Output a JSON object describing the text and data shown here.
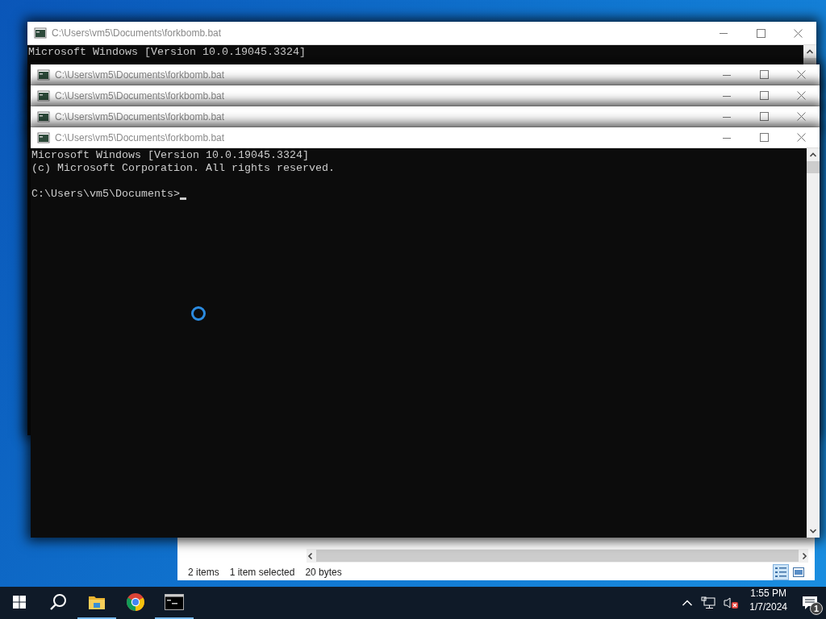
{
  "windows": [
    {
      "kind": "console",
      "title": "C:\\Users\\vm5\\Documents\\forkbomb.bat",
      "lines": [
        "Microsoft Windows [Version 10.0.19045.3324]"
      ]
    },
    {
      "kind": "titlebar",
      "title": "C:\\Users\\vm5\\Documents\\forkbomb.bat"
    },
    {
      "kind": "titlebar",
      "title": "C:\\Users\\vm5\\Documents\\forkbomb.bat"
    },
    {
      "kind": "titlebar",
      "title": "C:\\Users\\vm5\\Documents\\forkbomb.bat"
    },
    {
      "kind": "console",
      "title": "C:\\Users\\vm5\\Documents\\forkbomb.bat",
      "lines": [
        "Microsoft Windows [Version 10.0.19045.3324]",
        "(c) Microsoft Corporation. All rights reserved."
      ],
      "prompt": "C:\\Users\\vm5\\Documents>",
      "busy": true
    }
  ],
  "explorer": {
    "item_count": "2 items",
    "selection": "1 item selected",
    "size": "20 bytes",
    "views": [
      {
        "kind": "details",
        "selected": true
      },
      {
        "kind": "preview",
        "selected": false
      }
    ]
  },
  "taskbar": {
    "apps": [
      {
        "kind": "folder",
        "running": true
      },
      {
        "kind": "browser",
        "running": false
      },
      {
        "kind": "console",
        "running": true
      }
    ],
    "time": "1:55 PM",
    "date": "1/7/2024",
    "notifications": "1"
  }
}
